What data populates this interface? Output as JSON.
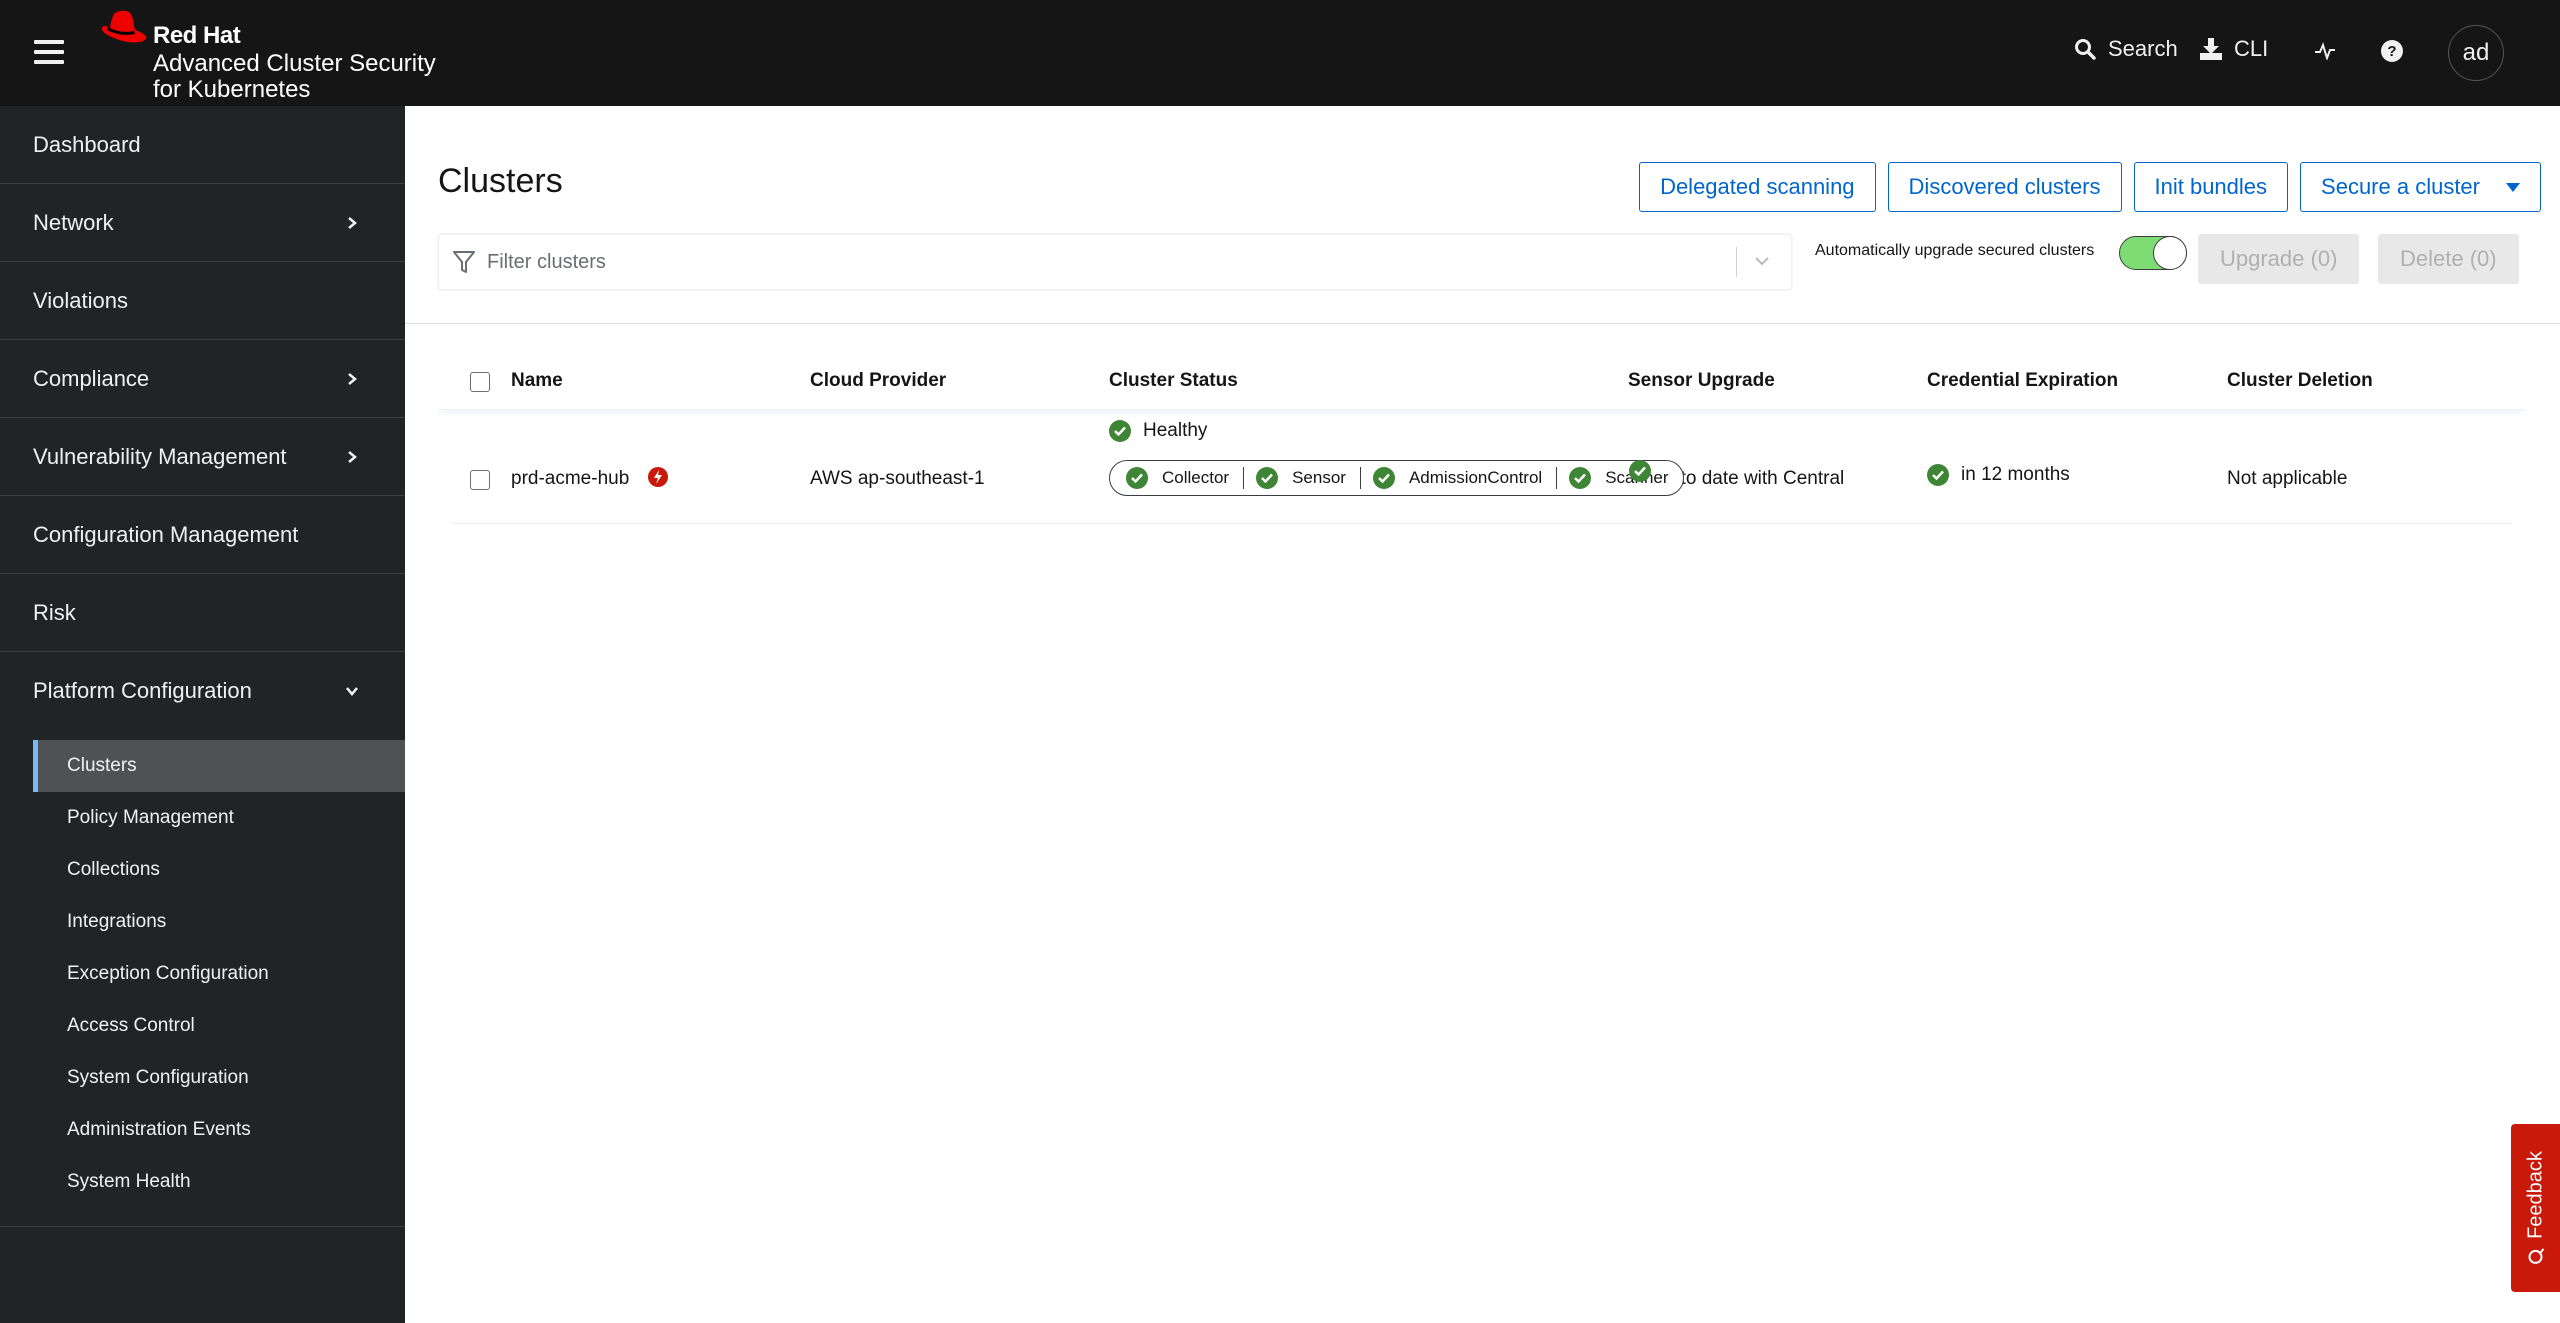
{
  "masthead": {
    "brand_line1": "Red Hat",
    "brand_line2": "Advanced Cluster Security",
    "brand_line3": "for Kubernetes",
    "search_label": "Search",
    "cli_label": "CLI",
    "avatar_initials": "ad"
  },
  "sidebar": {
    "items": [
      {
        "label": "Dashboard",
        "expandable": false
      },
      {
        "label": "Network",
        "expandable": true
      },
      {
        "label": "Violations",
        "expandable": false
      },
      {
        "label": "Compliance",
        "expandable": true
      },
      {
        "label": "Vulnerability Management",
        "expandable": true
      },
      {
        "label": "Configuration Management",
        "expandable": false
      },
      {
        "label": "Risk",
        "expandable": false
      },
      {
        "label": "Platform Configuration",
        "expandable": true,
        "expanded": true
      }
    ],
    "sub_items": [
      {
        "label": "Clusters",
        "active": true
      },
      {
        "label": "Policy Management"
      },
      {
        "label": "Collections"
      },
      {
        "label": "Integrations"
      },
      {
        "label": "Exception Configuration"
      },
      {
        "label": "Access Control"
      },
      {
        "label": "System Configuration"
      },
      {
        "label": "Administration Events"
      },
      {
        "label": "System Health"
      }
    ]
  },
  "page": {
    "title": "Clusters",
    "buttons": {
      "delegated_scanning": "Delegated scanning",
      "discovered_clusters": "Discovered clusters",
      "init_bundles": "Init bundles",
      "secure_cluster": "Secure a cluster"
    },
    "filter_placeholder": "Filter clusters",
    "auto_upgrade_label": "Automatically upgrade secured clusters",
    "auto_upgrade_enabled": true,
    "upgrade_button": "Upgrade (0)",
    "delete_button": "Delete (0)"
  },
  "table": {
    "columns": [
      "Name",
      "Cloud Provider",
      "Cluster Status",
      "Sensor Upgrade",
      "Credential Expiration",
      "Cluster Deletion"
    ],
    "rows": [
      {
        "name": "prd-acme-hub",
        "cloud_provider": "AWS ap-southeast-1",
        "cluster_status": "Healthy",
        "components": [
          "Collector",
          "Sensor",
          "AdmissionControl",
          "Scanner"
        ],
        "sensor_upgrade": "Up to date with Central",
        "credential_expiration": "in 12 months",
        "cluster_deletion": "Not applicable"
      }
    ]
  },
  "feedback_label": "Feedback",
  "colors": {
    "accent": "#0066cc",
    "success": "#3e8635",
    "danger": "#c9190b",
    "toggle_on": "#7ddc74",
    "nav_active_border": "#73bcf7"
  }
}
